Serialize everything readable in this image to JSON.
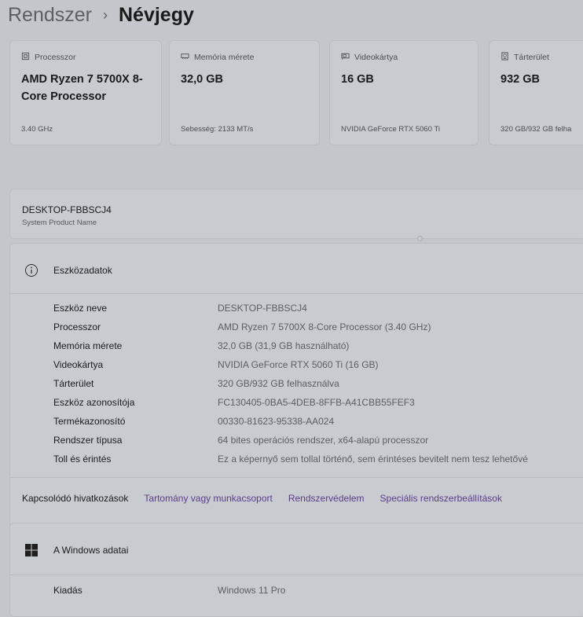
{
  "breadcrumb": {
    "parent": "Rendszer",
    "separator": "›",
    "current": "Névjegy"
  },
  "cards": [
    {
      "icon": "processor-icon",
      "label": "Processzor",
      "value": "AMD Ryzen 7 5700X 8-Core Processor",
      "sub": "3.40 GHz"
    },
    {
      "icon": "memory-icon",
      "label": "Memória mérete",
      "value": "32,0 GB",
      "sub": "Sebesség: 2133 MT/s"
    },
    {
      "icon": "gpu-icon",
      "label": "Videokártya",
      "value": "16 GB",
      "sub": "NVIDIA GeForce RTX 5060 Ti"
    },
    {
      "icon": "storage-icon",
      "label": "Tárterület",
      "value": "932 GB",
      "sub": "320 GB/932 GB felha"
    }
  ],
  "device": {
    "name": "DESKTOP-FBBSCJ4",
    "model": "System Product Name"
  },
  "specs": {
    "title": "Eszközadatok",
    "rows": [
      {
        "key": "Eszköz neve",
        "value": "DESKTOP-FBBSCJ4"
      },
      {
        "key": "Processzor",
        "value": "AMD Ryzen 7 5700X 8-Core Processor (3.40 GHz)"
      },
      {
        "key": "Memória mérete",
        "value": "32,0 GB (31,9 GB használható)"
      },
      {
        "key": "Videokártya",
        "value": "NVIDIA GeForce RTX 5060 Ti (16 GB)"
      },
      {
        "key": "Tárterület",
        "value": "320 GB/932 GB felhasználva"
      },
      {
        "key": "Eszköz azonosítója",
        "value": "FC130405-0BA5-4DEB-8FFB-A41CBB55FEF3"
      },
      {
        "key": "Termékazonosító",
        "value": "00330-81623-95338-AA024"
      },
      {
        "key": "Rendszer típusa",
        "value": "64 bites operációs rendszer, x64-alapú processzor"
      },
      {
        "key": "Toll és érintés",
        "value": "Ez a képernyő sem tollal történő, sem érintéses bevitelt nem tesz lehetővé"
      }
    ]
  },
  "related": {
    "label": "Kapcsolódó hivatkozások",
    "links": [
      "Tartomány vagy munkacsoport",
      "Rendszervédelem",
      "Speciális rendszerbeállítások"
    ]
  },
  "windows": {
    "title": "A Windows adatai",
    "rows": [
      {
        "key": "Kiadás",
        "value": "Windows 11 Pro"
      }
    ]
  },
  "colors": {
    "link": "#5e3a8c",
    "background": "#c3c7cc",
    "card": "#c8ccd1"
  }
}
